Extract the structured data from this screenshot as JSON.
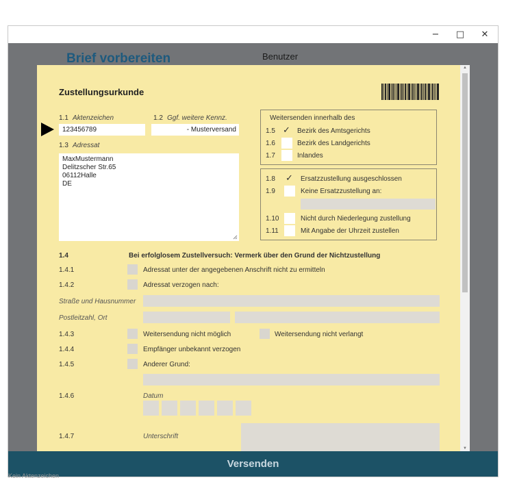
{
  "window": {
    "minimize_glyph": "−",
    "maximize_glyph": "□",
    "close_glyph": "✕"
  },
  "app": {
    "title": "Brief vorbereiten",
    "user_label": "Benutzer",
    "send_button": "Versenden",
    "footer": "Kein Aktenzeichen"
  },
  "form": {
    "heading": "Zustellungsurkunde",
    "f1_1": {
      "num": "1.1",
      "label": "Aktenzeichen",
      "value": "123456789"
    },
    "f1_2": {
      "num": "1.2",
      "label": "Ggf. weitere Kennz.",
      "value": "- Musterversand"
    },
    "f1_3": {
      "num": "1.3",
      "label": "Adressat",
      "lines": [
        "MaxMustermann",
        "Delitzscher Str.65",
        "06112Halle",
        "DE"
      ]
    },
    "forward_group": {
      "title": "Weitersenden innerhalb des",
      "items": [
        {
          "num": "1.5",
          "label": "Bezirk des Amtsgerichts",
          "checked": true
        },
        {
          "num": "1.6",
          "label": "Bezirk des Landgerichts",
          "checked": false
        },
        {
          "num": "1.7",
          "label": "Inlandes",
          "checked": false
        }
      ]
    },
    "substitute_group": {
      "items": [
        {
          "num": "1.8",
          "label": "Ersatzzustellung ausgeschlossen",
          "checked": true
        },
        {
          "num": "1.9",
          "label": "Keine Ersatzzustellung an:",
          "checked": false
        },
        {
          "num": "1.10",
          "label": "Nicht durch Niederlegung zustellung",
          "checked": false
        },
        {
          "num": "1.11",
          "label": "Mit Angabe der Uhrzeit zustellen",
          "checked": false
        }
      ]
    },
    "section_1_4": {
      "num": "1.4",
      "title": "Bei erfolglosem Zustellversuch: Vermerk über den Grund der Nichtzustellung"
    },
    "r1_4_1": {
      "num": "1.4.1",
      "label": "Adressat unter der angegebenen Anschrift nicht zu ermitteln"
    },
    "r1_4_2": {
      "num": "1.4.2",
      "label": "Adressat verzogen nach:"
    },
    "street_label": "Straße und Hausnummer",
    "city_label": "Postleitzahl, Ort",
    "r1_4_3": {
      "num": "1.4.3",
      "label": "Weitersendung nicht möglich",
      "label2": "Weitersendung nicht verlangt"
    },
    "r1_4_4": {
      "num": "1.4.4",
      "label": "Empfänger unbekannt verzogen"
    },
    "r1_4_5": {
      "num": "1.4.5",
      "label": "Anderer Grund:"
    },
    "r1_4_6": {
      "num": "1.4.6",
      "label": "Datum"
    },
    "r1_4_7": {
      "num": "1.4.7",
      "label": "Unterschrift"
    }
  }
}
